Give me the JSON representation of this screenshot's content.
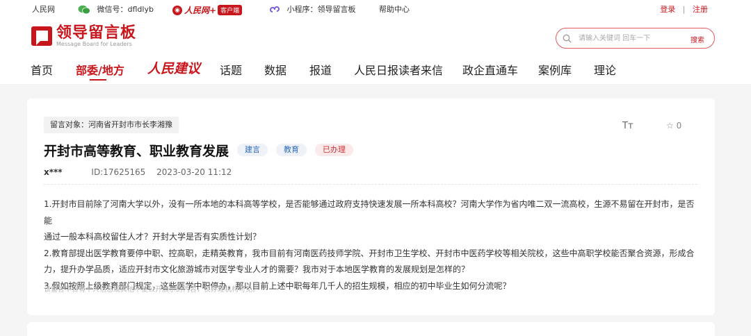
{
  "topbar": {
    "site": "人民网",
    "wechat": "微信号：dfldlyb",
    "client_name": "人民网+",
    "client_tag": "客户端",
    "mini": "小程序：领导留言板",
    "help": "帮助中心",
    "login": "登录",
    "sep": "|",
    "register": "注册"
  },
  "logo": {
    "title": "领导留言板",
    "subtitle": "Message Board for Leaders"
  },
  "search": {
    "placeholder": "请输入关键词 回车一下",
    "button": "搜索"
  },
  "nav": {
    "items": [
      "首页",
      "部委/地方",
      "人民建议",
      "话题",
      "数据",
      "报道",
      "人民日报读者来信",
      "政企直通车",
      "案例库",
      "理论"
    ],
    "active_index": 1
  },
  "message": {
    "target": "留言对象：河南省开封市市长李湘豫",
    "font_tool": "Tт",
    "favorite_count": "0",
    "title": "开封市高等教育、职业教育发展",
    "tags": [
      "建言",
      "教育",
      "已办理"
    ],
    "author": "x***",
    "id": "ID:17625165",
    "datetime": "2023-03-20 11:12",
    "lines": [
      "1.开封市目前除了河南大学以外，没有一所本地的本科高等学校，是否能够通过政府支持快速发展一所本科高校？河南大学作为省内唯二双一流高校，生源不易留在开封市，是否能",
      "通过一般本科高校留住人才？开封大学是否有实质性计划？",
      "2.教育部提出医学教育要停中职、控高职，走精英教育，我市目前有河南医药技师学院、开封市卫生学校、开封市中医药学校等相关院校，这些中高职学校能否聚合资源，形成合",
      "力，提升办学品质，适应开封市文化旅游城市对医学专业人才的需要？我市对于本地医学教育的发展规划是怎样的？",
      "3.假如按照上级教育部门规定，这些医学中职停办，那以目前上述中职每年几千人的招生规模，相应的初中毕业生如何分流呢？"
    ],
    "privacy_note": "该留言中含有个人信息或其他不便公开展示的内容，仅办理机构可见。"
  },
  "colors": {
    "brand": "#c8161d",
    "tag_blue": "#2f6bb8",
    "tag_red": "#d0333a"
  }
}
